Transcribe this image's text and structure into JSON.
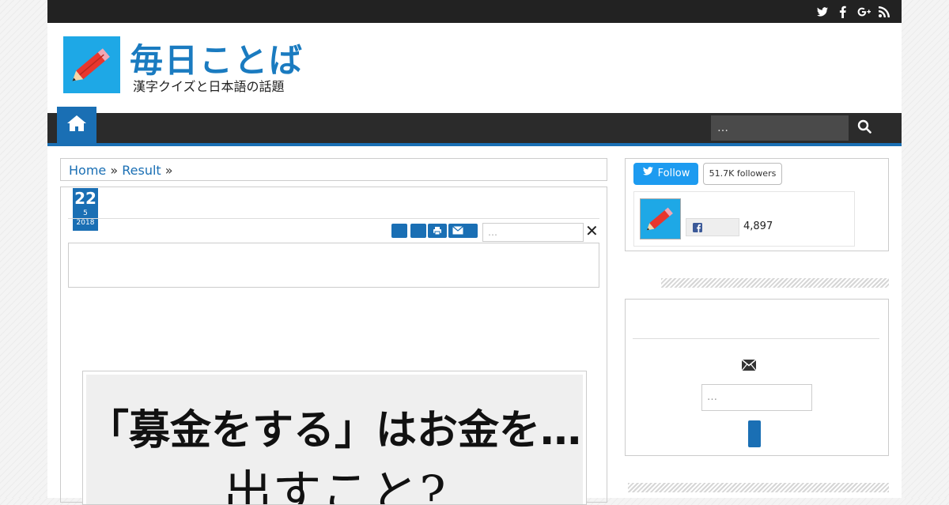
{
  "colors": {
    "accent": "#1a6fb4",
    "topbar": "#222222",
    "nav": "#2b2b2b",
    "twitter": "#1d9bf0"
  },
  "topbar": {
    "icons": [
      "twitter-icon",
      "facebook-icon",
      "google-plus-icon",
      "rss-icon"
    ]
  },
  "header": {
    "title": "毎日ことば",
    "tagline": "漢字クイズと日本語の話題"
  },
  "nav": {
    "home_icon": "home-icon",
    "search_placeholder": "…",
    "search_icon": "search-icon"
  },
  "breadcrumb": {
    "home": "Home",
    "sep1": "»",
    "result": "Result",
    "sep2": "»"
  },
  "post": {
    "date": {
      "day": "22",
      "month": "5",
      "year": "2018"
    },
    "share": {
      "buttons": [
        "share-button",
        "share-button",
        "print-icon",
        "email-icon"
      ],
      "input_placeholder": "…",
      "close": "✕"
    },
    "quiz_image": {
      "line1": "「募金をする」はお金を…",
      "line2": "出すこと?"
    }
  },
  "sidebar": {
    "twitter": {
      "follow_label": "Follow",
      "followers": "51.7K followers"
    },
    "facebook": {
      "count": "4,897"
    },
    "subscribe": {
      "input_placeholder": "…"
    }
  }
}
